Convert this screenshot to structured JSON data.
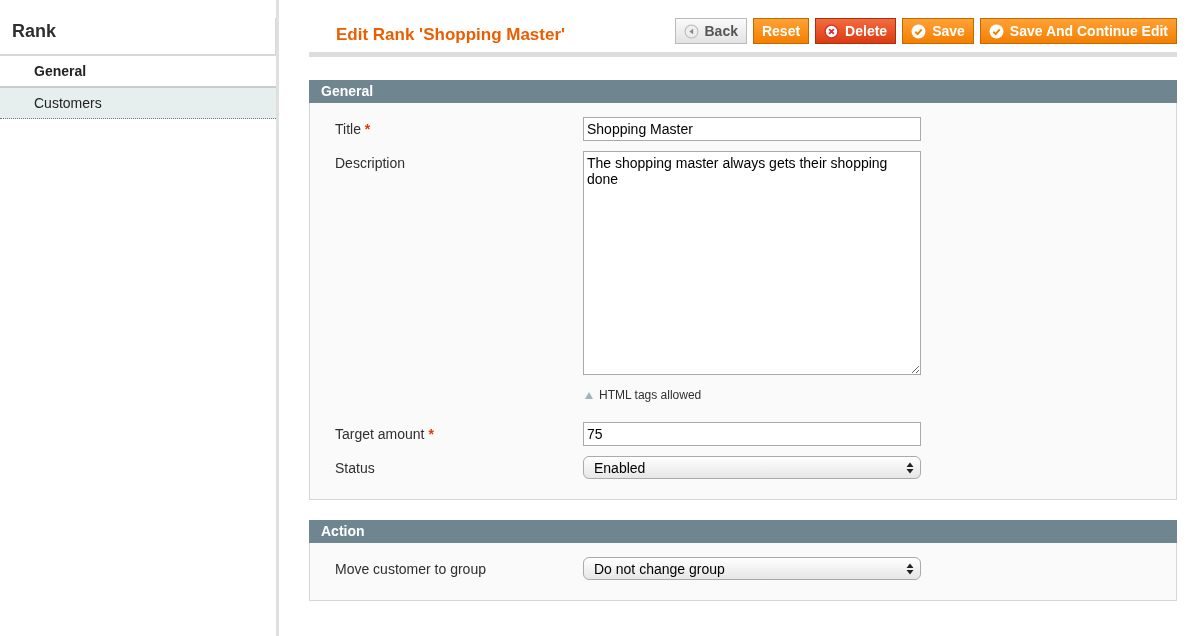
{
  "sidebar": {
    "title": "Rank",
    "tabs": [
      {
        "label": "General",
        "selected": true
      },
      {
        "label": "Customers",
        "selected": false
      }
    ]
  },
  "page_title": "Edit Rank 'Shopping Master'",
  "buttons": [
    {
      "label": "Back",
      "kind": "back"
    },
    {
      "label": "Reset",
      "kind": "plain"
    },
    {
      "label": "Delete",
      "kind": "delete"
    },
    {
      "label": "Save",
      "kind": "save"
    },
    {
      "label": "Save And Continue Edit",
      "kind": "save"
    }
  ],
  "sections": [
    {
      "title": "General",
      "fields": [
        {
          "label": "Title",
          "required_mark": "*",
          "kind": "text",
          "value": "Shopping Master"
        },
        {
          "label": "Description",
          "kind": "textarea",
          "value": "The shopping master always gets their shopping done",
          "note": "HTML tags allowed"
        },
        {
          "label": "Target amount",
          "required_mark": "*",
          "kind": "text",
          "value": "75"
        },
        {
          "label": "Status",
          "kind": "select",
          "value": "Enabled"
        }
      ]
    },
    {
      "title": "Action",
      "fields": [
        {
          "label": "Move customer to group",
          "kind": "select",
          "value": "Do not change group"
        }
      ]
    }
  ]
}
